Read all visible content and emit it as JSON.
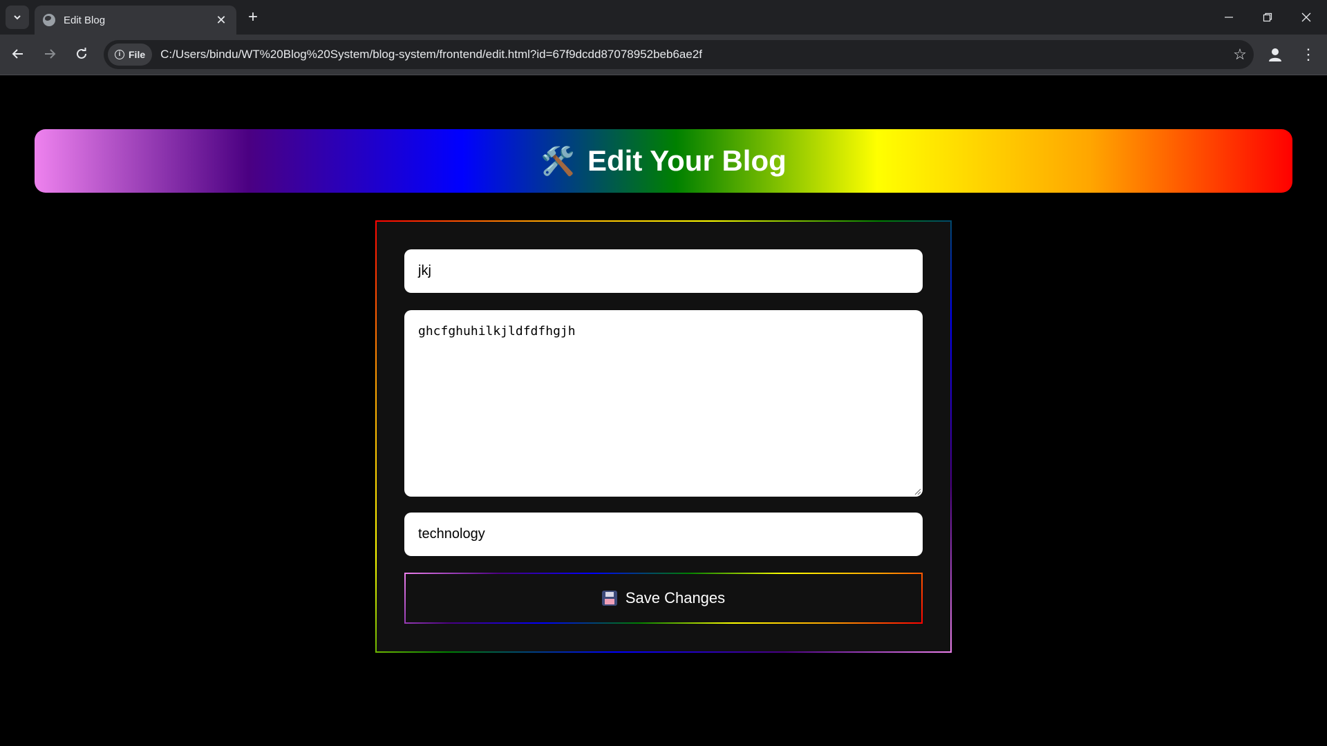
{
  "browser": {
    "tab_title": "Edit Blog",
    "close_symbol": "✕",
    "new_tab_symbol": "+",
    "chip_label": "File",
    "url": "C:/Users/bindu/WT%20Blog%20System/blog-system/frontend/edit.html?id=67f9dcdd87078952beb6ae2f"
  },
  "page": {
    "heading": "Edit Your Blog",
    "heading_icon": "🛠️",
    "title_value": "jkj",
    "content_value": "ghcfghuhilkjldfdfhgjh",
    "category_value": "technology",
    "save_label": "Save Changes"
  },
  "colors": {
    "page_bg": "#000000",
    "card_bg": "#111111",
    "rainbow": [
      "#ee82ee",
      "#4b0082",
      "#0000ff",
      "#008000",
      "#ffff00",
      "#ffa500",
      "#ff0000"
    ]
  }
}
